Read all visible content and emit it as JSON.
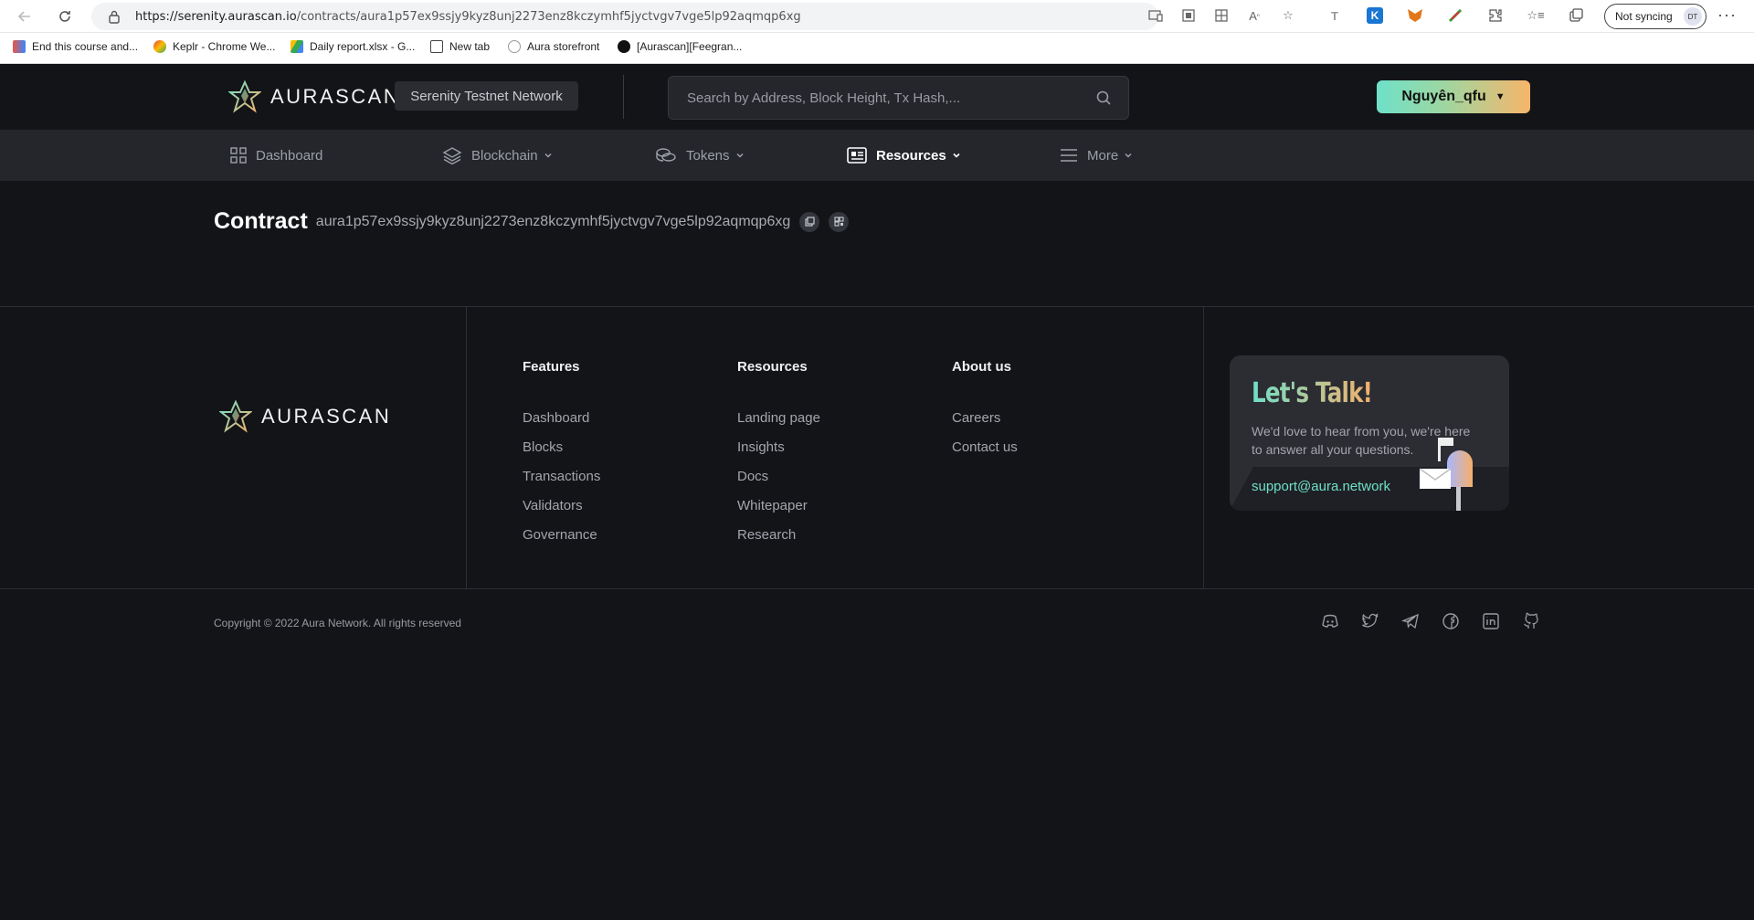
{
  "browser": {
    "url_host": "https://serenity.aurascan.io",
    "url_path": "/contracts/aura1p57ex9ssjy9kyz8unj2273enz8kczymhf5jyctvgv7vge5lp92aqmqp6xg",
    "profile_status": "Not syncing",
    "profile_initials": "DT",
    "bookmarks": [
      {
        "label": "End this course and..."
      },
      {
        "label": "Keplr - Chrome We..."
      },
      {
        "label": "Daily report.xlsx - G..."
      },
      {
        "label": "New tab"
      },
      {
        "label": "Aura storefront"
      },
      {
        "label": "[Aurascan][Feegran..."
      }
    ]
  },
  "header": {
    "brand": "AURASCAN",
    "network": "Serenity Testnet Network",
    "search_placeholder": "Search by Address, Block Height, Tx Hash,...",
    "wallet_label": "Nguyên_qfu"
  },
  "nav": {
    "items": [
      {
        "label": "Dashboard"
      },
      {
        "label": "Blockchain"
      },
      {
        "label": "Tokens"
      },
      {
        "label": "Resources"
      },
      {
        "label": "More"
      }
    ],
    "active": "Resources"
  },
  "page": {
    "title": "Contract",
    "address": "aura1p57ex9ssjy9kyz8unj2273enz8kczymhf5jyctvgv7vge5lp92aqmqp6xg"
  },
  "footer": {
    "brand": "AURASCAN",
    "columns": [
      {
        "title": "Features",
        "links": [
          "Dashboard",
          "Blocks",
          "Transactions",
          "Validators",
          "Governance"
        ]
      },
      {
        "title": "Resources",
        "links": [
          "Landing page",
          "Insights",
          "Docs",
          "Whitepaper",
          "Research"
        ]
      },
      {
        "title": "About us",
        "links": [
          "Careers",
          "Contact us"
        ]
      }
    ],
    "talk": {
      "title": "Let's Talk!",
      "subtitle": "We'd love to hear from you, we're here to answer all your questions.",
      "email": "support@aura.network"
    },
    "copyright": "Copyright © 2022 Aura Network. All rights reserved",
    "social_icons": [
      "discord-icon",
      "twitter-icon",
      "telegram-icon",
      "facebook-icon",
      "linkedin-icon",
      "github-icon"
    ]
  },
  "colors": {
    "background": "#131418",
    "navbar": "#24262c",
    "accent_teal": "#6fe0c8",
    "accent_orange": "#f5b06b"
  }
}
